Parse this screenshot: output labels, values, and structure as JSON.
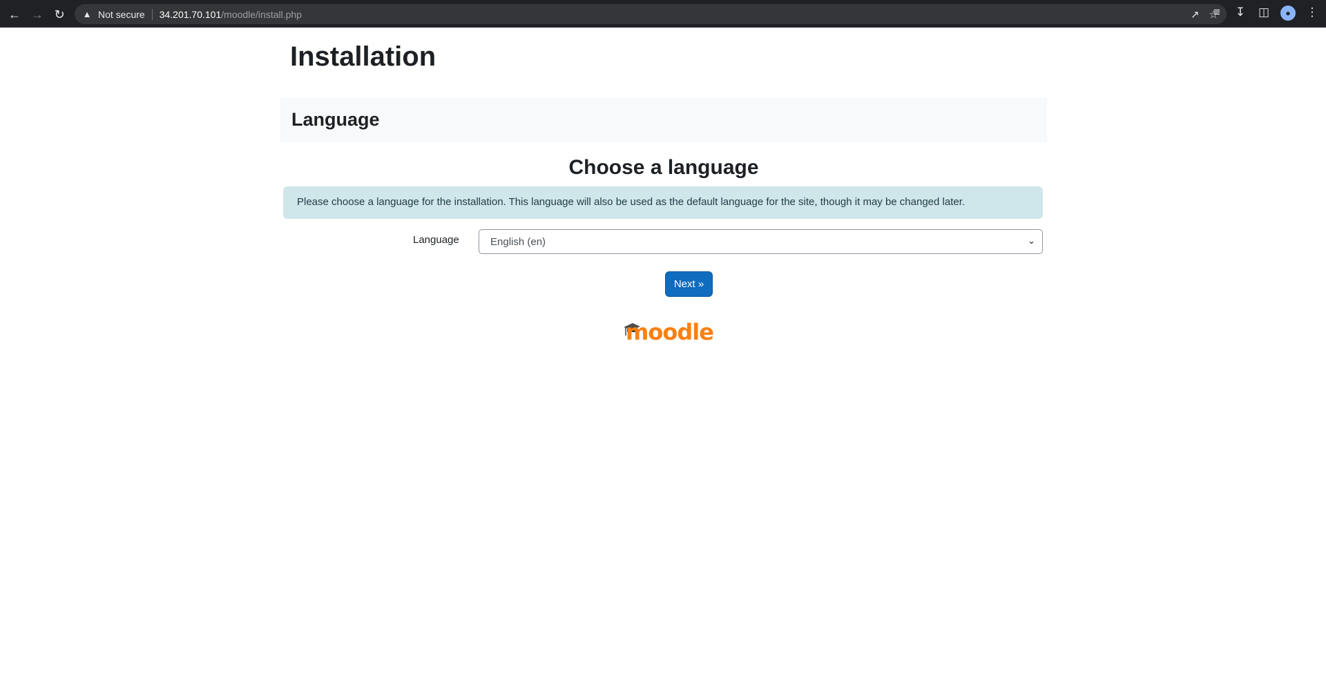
{
  "browser": {
    "back_icon": "arrow-left-icon",
    "forward_icon": "arrow-right-icon",
    "reload_icon": "reload-icon",
    "security_label": "Not secure",
    "url_host": "34.201.70.101",
    "url_path": "/moodle/install.php"
  },
  "page": {
    "title": "Installation",
    "section_title": "Language",
    "heading": "Choose a language",
    "info_text": "Please choose a language for the installation. This language will also be used as the default language for the site, though it may be changed later.",
    "language_label": "Language",
    "language_selected": "English (en)",
    "next_label": "Next »"
  },
  "brand": {
    "logo_text": "moodle",
    "accent": "#f98012",
    "button_color": "#0f6cbf",
    "alert_bg": "#cfe6ea"
  }
}
